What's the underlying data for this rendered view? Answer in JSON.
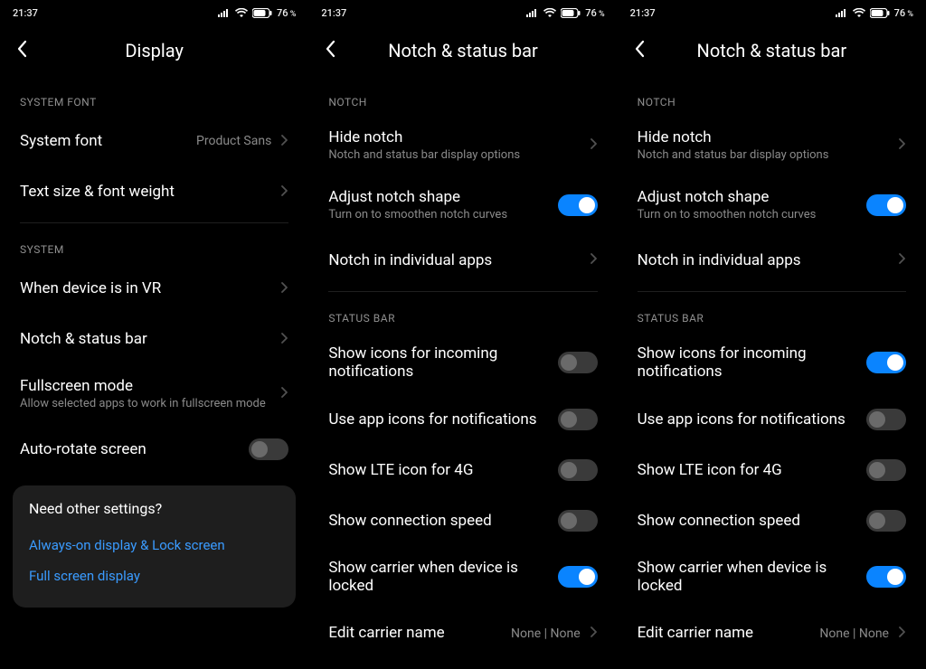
{
  "status": {
    "time": "21:37",
    "battery": "76"
  },
  "panels": [
    {
      "title": "Display",
      "sections": [
        {
          "header": "SYSTEM FONT",
          "items": [
            {
              "title": "System font",
              "value": "Product Sans",
              "type": "nav"
            },
            {
              "title": "Text size & font weight",
              "type": "nav"
            }
          ],
          "divider_after": true
        },
        {
          "header": "SYSTEM",
          "items": [
            {
              "title": "When device is in VR",
              "type": "nav"
            },
            {
              "title": "Notch & status bar",
              "type": "nav"
            },
            {
              "title": "Fullscreen mode",
              "sub": "Allow selected apps to work in fullscreen mode",
              "type": "nav"
            },
            {
              "title": "Auto-rotate screen",
              "type": "toggle",
              "on": false
            }
          ]
        }
      ],
      "card": {
        "title": "Need other settings?",
        "links": [
          "Always-on display & Lock screen",
          "Full screen display"
        ]
      }
    },
    {
      "title": "Notch & status bar",
      "sections": [
        {
          "header": "NOTCH",
          "items": [
            {
              "title": "Hide notch",
              "sub": "Notch and status bar display options",
              "type": "nav"
            },
            {
              "title": "Adjust notch shape",
              "sub": "Turn on to smoothen notch curves",
              "type": "toggle",
              "on": true
            },
            {
              "title": "Notch in individual apps",
              "type": "nav"
            }
          ],
          "divider_after": true
        },
        {
          "header": "STATUS BAR",
          "items": [
            {
              "title": "Show icons for incoming notifications",
              "type": "toggle",
              "on": false
            },
            {
              "title": "Use app icons for notifications",
              "type": "toggle",
              "on": false
            },
            {
              "title": "Show LTE icon for 4G",
              "type": "toggle",
              "on": false
            },
            {
              "title": "Show connection speed",
              "type": "toggle",
              "on": false
            },
            {
              "title": "Show carrier when device is locked",
              "type": "toggle",
              "on": true
            },
            {
              "title": "Edit carrier name",
              "value": "None | None",
              "type": "nav"
            }
          ]
        }
      ]
    },
    {
      "title": "Notch & status bar",
      "sections": [
        {
          "header": "NOTCH",
          "items": [
            {
              "title": "Hide notch",
              "sub": "Notch and status bar display options",
              "type": "nav"
            },
            {
              "title": "Adjust notch shape",
              "sub": "Turn on to smoothen notch curves",
              "type": "toggle",
              "on": true
            },
            {
              "title": "Notch in individual apps",
              "type": "nav"
            }
          ],
          "divider_after": true
        },
        {
          "header": "STATUS BAR",
          "items": [
            {
              "title": "Show icons for incoming notifications",
              "type": "toggle",
              "on": true
            },
            {
              "title": "Use app icons for notifications",
              "type": "toggle",
              "on": false
            },
            {
              "title": "Show LTE icon for 4G",
              "type": "toggle",
              "on": false
            },
            {
              "title": "Show connection speed",
              "type": "toggle",
              "on": false
            },
            {
              "title": "Show carrier when device is locked",
              "type": "toggle",
              "on": true
            },
            {
              "title": "Edit carrier name",
              "value": "None | None",
              "type": "nav"
            }
          ]
        }
      ]
    }
  ]
}
